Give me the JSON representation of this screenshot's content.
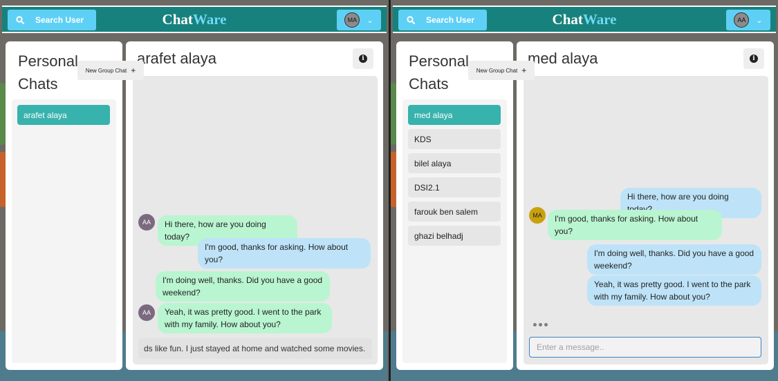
{
  "header": {
    "search_label": "Search User",
    "brand_part1": "Chat",
    "brand_part2": "Ware"
  },
  "left_window": {
    "user_initials": "MA",
    "chats_title_line1": "Personal",
    "chats_title_line2": "Chats",
    "new_group_label": "New Group Chat",
    "chats": [
      {
        "name": "arafet alaya",
        "active": true
      }
    ],
    "chat_title": "arafet alaya",
    "messages": [
      {
        "text": "Hi there, how are you doing today?",
        "from": "other",
        "avatar": "AA"
      },
      {
        "text": "I'm good, thanks for asking. How about you?",
        "from": "me"
      },
      {
        "text": "I'm doing well, thanks. Did you have a good weekend?",
        "from": "other"
      },
      {
        "text": "Yeah, it was pretty good. I went to the park with my family. How about you?",
        "from": "other",
        "avatar": "AA"
      }
    ],
    "message_input_value": "ds like fun. I just stayed at home and watched some movies."
  },
  "right_window": {
    "user_initials": "AA",
    "chats_title_line1": "Personal",
    "chats_title_line2": "Chats",
    "new_group_label": "New Group Chat",
    "chats": [
      {
        "name": "med alaya",
        "active": true
      },
      {
        "name": "KDS",
        "active": false
      },
      {
        "name": "bilel alaya",
        "active": false
      },
      {
        "name": "DSI2.1",
        "active": false
      },
      {
        "name": "farouk ben salem",
        "active": false
      },
      {
        "name": "ghazi belhadj",
        "active": false
      }
    ],
    "chat_title": "med alaya",
    "messages": [
      {
        "text": "Hi there, how are you doing today?",
        "from": "me"
      },
      {
        "text": "I'm good, thanks for asking. How about you?",
        "from": "other",
        "avatar": "MA"
      },
      {
        "text": "I'm doing well, thanks. Did you have a good weekend?",
        "from": "me"
      },
      {
        "text": "Yeah, it was pretty good. I went to the park with my family. How about you?",
        "from": "me"
      }
    ],
    "message_input_placeholder": "Enter a message.."
  },
  "colors": {
    "header_bg": "#17827d",
    "button_bg": "#5fd0f5",
    "active_chat": "#38b2ac",
    "incoming_bubble": "#b9f5d0",
    "outgoing_bubble": "#bee3f8",
    "brand_accent": "#6fd9f6"
  },
  "icons": {
    "search": "search-icon",
    "chevron": "chevron-down-icon",
    "info": "info-icon",
    "add": "plus-icon",
    "typing": "typing-indicator-icon"
  }
}
